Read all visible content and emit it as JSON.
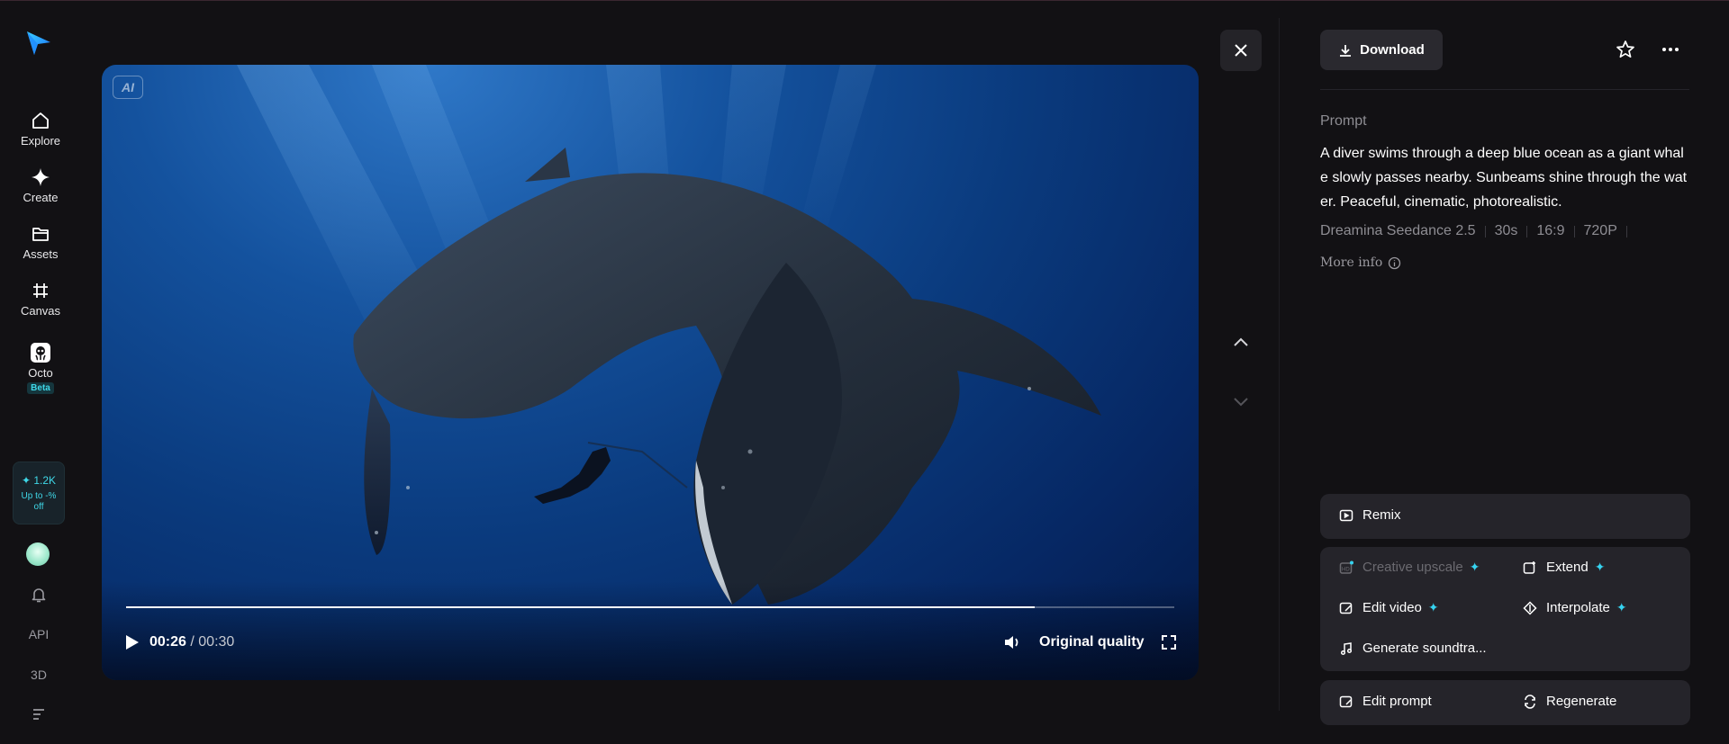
{
  "sidebar": {
    "items": [
      {
        "label": "Explore",
        "icon": "home-icon"
      },
      {
        "label": "Create",
        "icon": "diamond-icon"
      },
      {
        "label": "Assets",
        "icon": "folder-icon"
      },
      {
        "label": "Canvas",
        "icon": "canvas-icon"
      },
      {
        "label": "Octo",
        "icon": "octo-icon",
        "badge": "Beta"
      }
    ],
    "credits": {
      "amount": "✦ 1.2K",
      "promo": "Up to -% off"
    },
    "bottom": {
      "api": "API",
      "threed": "3D"
    }
  },
  "video": {
    "ai_badge": "AI",
    "current_time": "00:26",
    "separator": "/",
    "total_time": "00:30",
    "progress": 0.867,
    "quality": "Original quality"
  },
  "panel": {
    "download_label": "Download",
    "prompt_title": "Prompt",
    "prompt_text": "A diver swims through a deep blue ocean as a giant whale slowly passes nearby. Sunbeams shine through the water. Peaceful, cinematic, photorealistic.",
    "meta": [
      "Dreamina Seedance 2.5",
      "30s",
      "16:9",
      "720P"
    ],
    "more_info": "More info",
    "actions": {
      "remix": "Remix",
      "creative_upscale": "Creative upscale",
      "extend": "Extend",
      "edit_video": "Edit video",
      "interpolate": "Interpolate",
      "generate_soundtrack": "Generate soundtra...",
      "edit_prompt": "Edit prompt",
      "regenerate": "Regenerate"
    }
  },
  "colors": {
    "background": "#121114",
    "accent": "#36d3f0",
    "card": "#25242a"
  }
}
